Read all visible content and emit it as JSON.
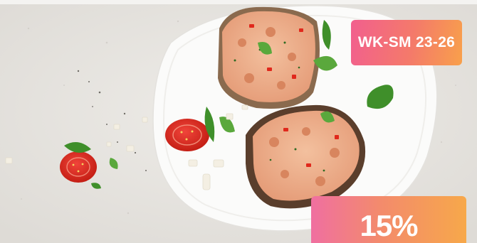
{
  "promo": {
    "week_badge": "WK-SM 23-26",
    "discount_label": "15%"
  },
  "colors": {
    "background": "#e9e7e3",
    "plate": "#ffffff",
    "badge_gradient_start": "#f25f8e",
    "badge_gradient_end": "#f8a04b",
    "tomato": "#e0281c",
    "basil": "#3f8f2a",
    "bread": "#6b4a34",
    "salad": "#efb08a"
  },
  "icons": [
    "tomato-icon",
    "basil-leaf-icon"
  ]
}
